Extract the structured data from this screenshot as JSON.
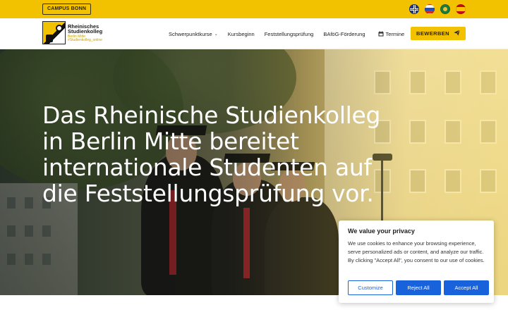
{
  "topbar": {
    "campus_label": "CAMPUS BONN",
    "languages": [
      {
        "name": "uk-flag-icon"
      },
      {
        "name": "russia-flag-icon"
      },
      {
        "name": "arabic-flag-icon"
      },
      {
        "name": "spain-flag-icon"
      }
    ]
  },
  "logo": {
    "title_line1": "Rheinisches",
    "title_line2": "Studienkolleg",
    "sub_line1": "Berlin Mitte",
    "sub_line2": "#Studienkolleg_online"
  },
  "nav": {
    "items": [
      {
        "label": "Schwerpunktkurse"
      },
      {
        "label": "Kursbeginn"
      },
      {
        "label": "Feststellungsprüfung"
      },
      {
        "label": "BAföG-Förderung"
      },
      {
        "label": "Termine"
      }
    ],
    "apply_label": "BEWERBEN"
  },
  "hero": {
    "title": "Das Rheinische Studienkolleg in Berlin Mitte bereitet internationale Studenten auf die Feststellungsprüfung vor."
  },
  "cookie": {
    "title": "We value your privacy",
    "text": "We use cookies to enhance your browsing experience, serve personalized ads or content, and analyze our traffic. By clicking \"Accept All\", you consent to our use of cookies.",
    "customize_label": "Customize",
    "reject_label": "Reject All",
    "accept_label": "Accept All"
  },
  "colors": {
    "brand_yellow": "#f2c200",
    "cookie_blue": "#1863dc"
  }
}
